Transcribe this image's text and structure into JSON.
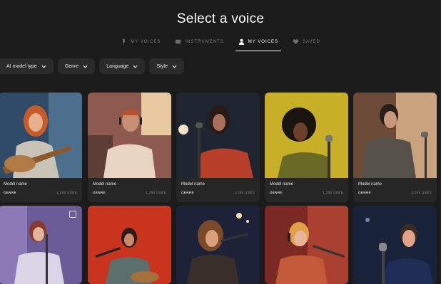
{
  "header": {
    "title": "Select a voice"
  },
  "tabs": [
    {
      "label": "MY VOICES",
      "icon": "mic-icon"
    },
    {
      "label": "INSTRUMENTS",
      "icon": "instrument-icon"
    },
    {
      "label": "MY VOICES",
      "icon": "person-icon",
      "active": true
    },
    {
      "label": "SAVED",
      "icon": "heart-icon"
    }
  ],
  "filters": [
    {
      "label": "AI model type"
    },
    {
      "label": "Genre"
    },
    {
      "label": "Language"
    },
    {
      "label": "Style"
    }
  ],
  "cards": [
    {
      "name": "Model name",
      "genre": "GENRE",
      "uses": "1,200 USES"
    },
    {
      "name": "Model name",
      "genre": "GENRE",
      "uses": "1,200 USES"
    },
    {
      "name": "Model name",
      "genre": "GENRE",
      "uses": "1,200 USES"
    },
    {
      "name": "Model name",
      "genre": "GENRE",
      "uses": "1,200 USES"
    },
    {
      "name": "Model name",
      "genre": "GENRE",
      "uses": "1,200 USES"
    }
  ],
  "colors": {
    "background": "#1b1b1b",
    "card": "#262626",
    "chip": "#2a2a2a"
  }
}
